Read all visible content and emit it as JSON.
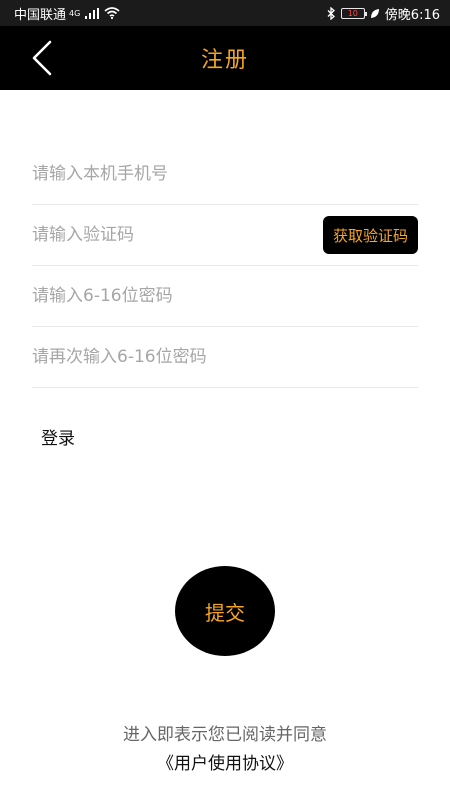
{
  "status_bar": {
    "carrier": "中国联通",
    "network_badge": "4G",
    "battery_level": "10",
    "time": "傍晚6:16"
  },
  "header": {
    "title": "注册",
    "background_color": "#000000",
    "accent_color": "#f5a623"
  },
  "form": {
    "phone_placeholder": "请输入本机手机号",
    "code_placeholder": "请输入验证码",
    "get_code_label": "获取验证码",
    "password_placeholder": "请输入6-16位密码",
    "confirm_password_placeholder": "请再次输入6-16位密码"
  },
  "login_label": "登录",
  "submit_label": "提交",
  "footer": {
    "agree_text": "进入即表示您已阅读并同意",
    "agreement_link": "《用户使用协议》"
  }
}
